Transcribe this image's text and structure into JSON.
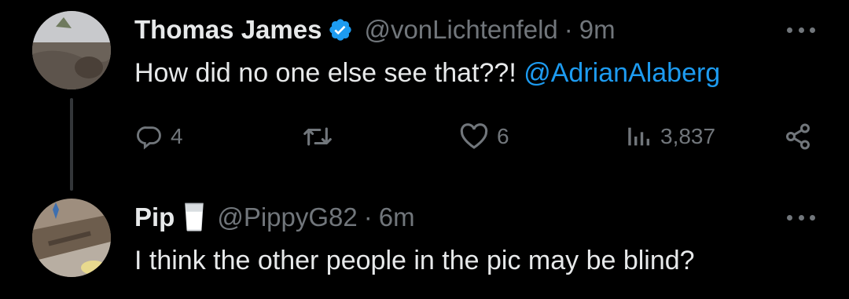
{
  "tweets": [
    {
      "name": "Thomas James",
      "handle": "@vonLichtenfeld",
      "separator": "·",
      "time": "9m",
      "text": "How did no one else see that??! ",
      "mention": "@AdrianAlaberg",
      "verified": true,
      "actions": {
        "replies": "4",
        "retweets": "",
        "likes": "6",
        "views": "3,837"
      }
    },
    {
      "name": "Pip",
      "handle": "@PippyG82",
      "separator": "·",
      "time": "6m",
      "text": "I think the other people in the pic may be blind?",
      "emoji": "glass-of-milk-emoji"
    }
  ],
  "icons": {
    "verified": "verified-badge-icon",
    "more": "more-dots-icon",
    "reply": "reply-icon",
    "retweet": "retweet-icon",
    "like": "heart-icon",
    "views": "views-bar-chart-icon",
    "share": "share-icon"
  },
  "colors": {
    "background": "#000000",
    "text": "#e7e9ea",
    "muted": "#71767b",
    "accent": "#1d9bf0",
    "thread_line": "#333639"
  }
}
